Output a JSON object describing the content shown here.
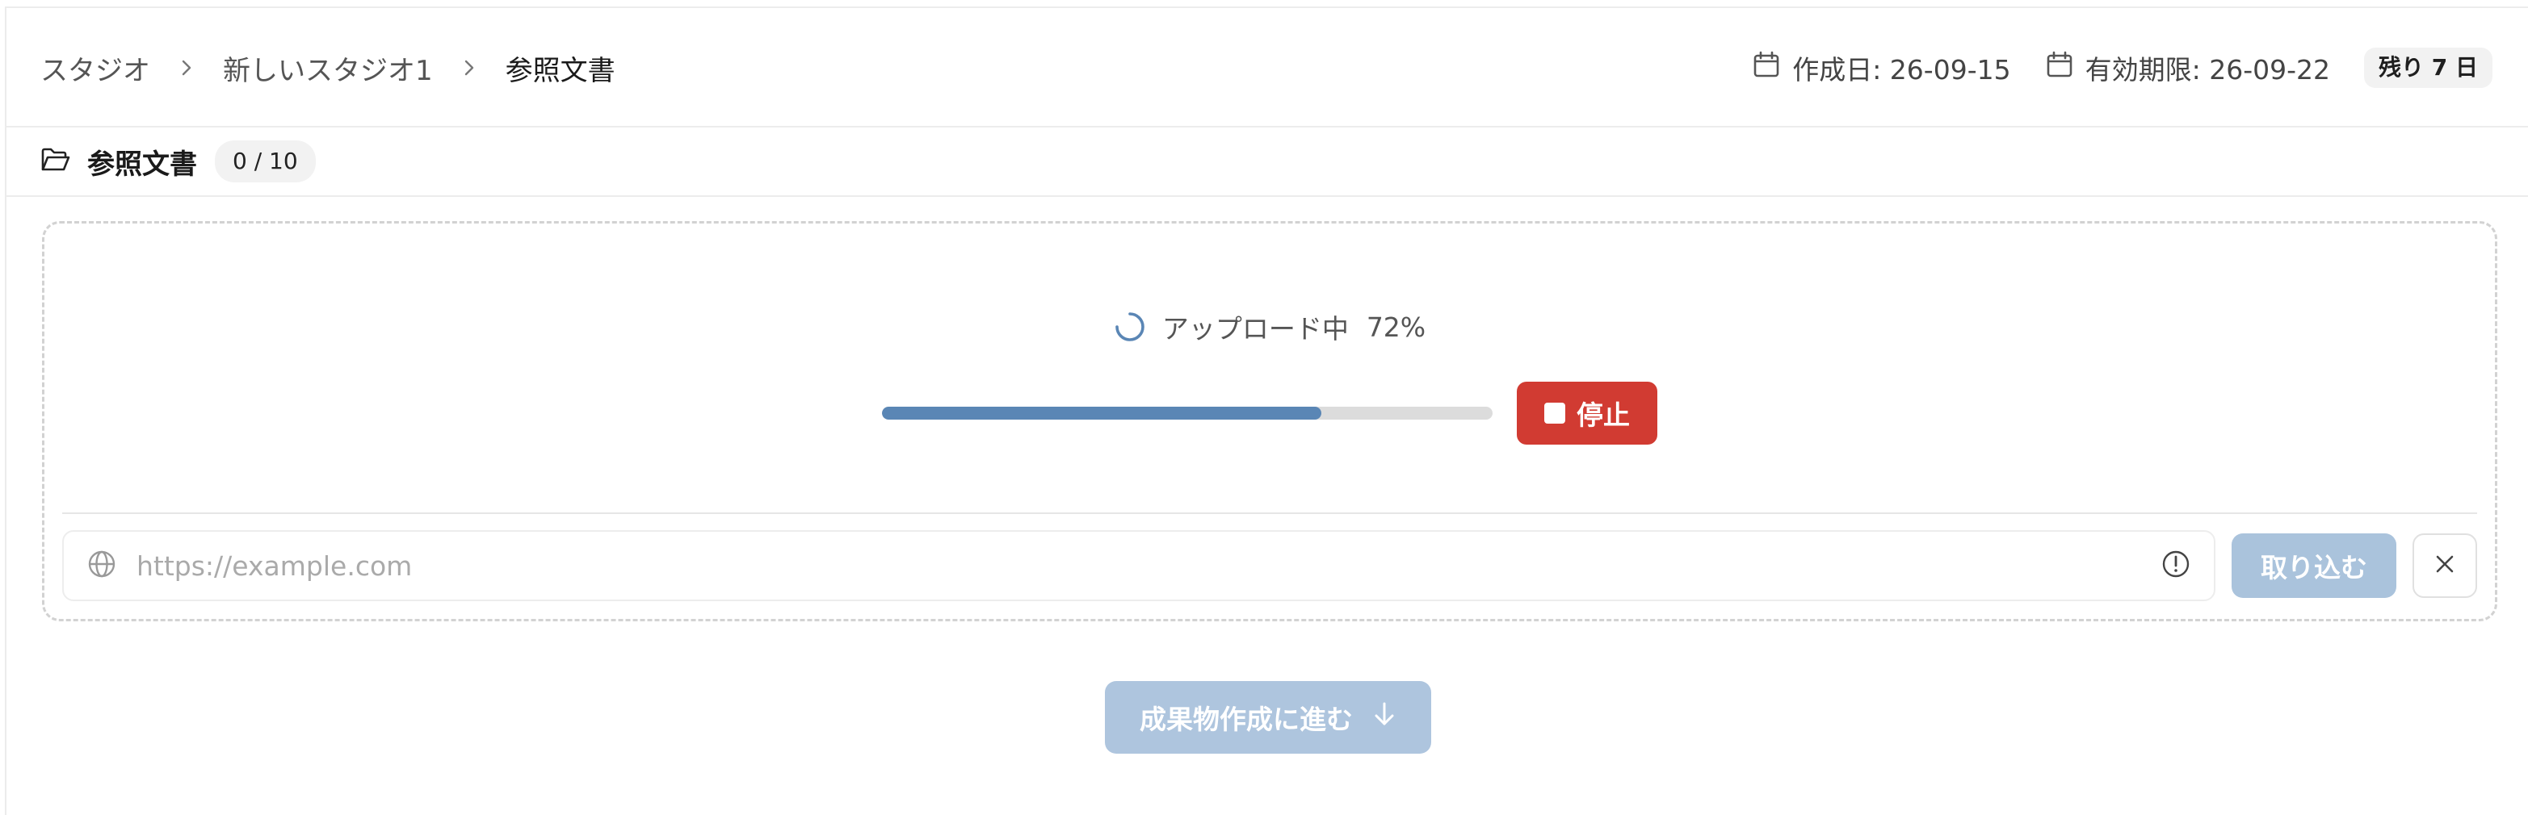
{
  "breadcrumb": {
    "items": [
      "スタジオ",
      "新しいスタジオ1",
      "参照文書"
    ]
  },
  "meta": {
    "created": "作成日: 26-09-15",
    "expires": "有効期限: 26-09-22",
    "remaining": "残り 7 日"
  },
  "section": {
    "title": "参照文書",
    "count": "0 / 10"
  },
  "upload": {
    "status": "アップロード中",
    "percent": "72%",
    "progress": 0.72,
    "stop_label": "停止"
  },
  "url": {
    "placeholder": "https://example.com",
    "value": "",
    "import_label": "取り込む"
  },
  "proceed": {
    "label": "成果物作成に進む"
  },
  "colors": {
    "accent": "#5a86b5",
    "stop": "#d13b32",
    "disabled_primary": "#aac3dc"
  },
  "icons": {
    "breadcrumb_separator": "chevron-right-icon",
    "date": "calendar-icon",
    "section": "folder-open-icon",
    "loading": "spinner-icon",
    "stop": "stop-icon",
    "url": "globe-icon",
    "info": "info-icon",
    "close": "close-icon",
    "proceed": "arrow-down-icon"
  }
}
